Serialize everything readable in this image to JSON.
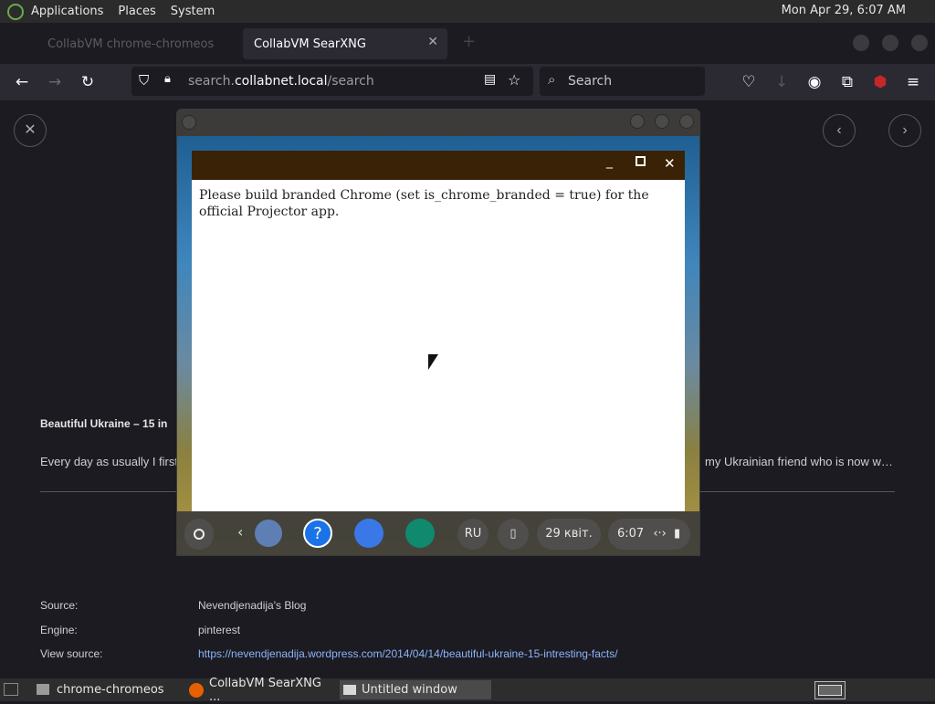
{
  "top_panel": {
    "menus": [
      "Applications",
      "Places",
      "System"
    ],
    "clock": "Mon Apr 29,  6:07 AM"
  },
  "browser": {
    "tab_inactive": "CollabVM chrome-chromeos",
    "tab_active": "CollabVM SearXNG",
    "url_domain_prefix": "search.",
    "url_domain": "collabnet.local",
    "url_path": "/search",
    "search_placeholder": "Search"
  },
  "page": {
    "result_title": "Beautiful Ukraine – 15 in",
    "result_text_left": "Every day as usually I first",
    "result_text_right": "my Ukrainian friend who is now w…",
    "meta": [
      {
        "label": "Source:",
        "value": "Nevendjenadija's Blog"
      },
      {
        "label": "Engine:",
        "value": "pinterest"
      },
      {
        "label": "View source:",
        "value": "https://nevendjenadija.wordpress.com/2014/04/14/beautiful-ukraine-15-intresting-facts/"
      }
    ]
  },
  "vm": {
    "dialog_message": "Please build branded Chrome (set is_chrome_branded = true) for the official Projector app.",
    "shelf": {
      "lang": "RU",
      "date": "29 квіт.",
      "time": "6:07"
    }
  },
  "taskbar": {
    "items": [
      "chrome-chromeos",
      "CollabVM SearXNG ...",
      "Untitled window"
    ]
  },
  "colors": {
    "accent_link": "#8ab4f8",
    "dialog_header": "#3a2206",
    "page_bg": "#1c1b22"
  }
}
